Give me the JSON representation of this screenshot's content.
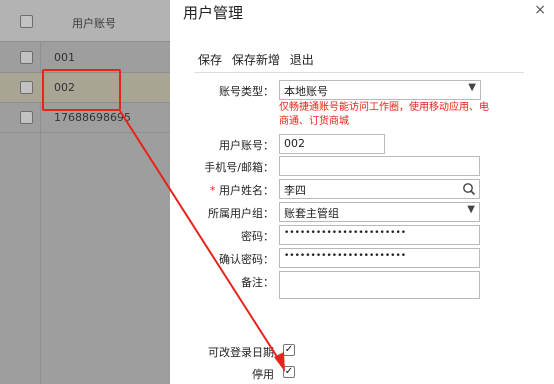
{
  "list": {
    "header": "用户账号",
    "rows": [
      "001",
      "002",
      "17688698695"
    ]
  },
  "dialog": {
    "title": "用户管理",
    "close": "×",
    "toolbar": {
      "save": "保存",
      "save_new": "保存新增",
      "exit": "退出"
    },
    "fields": {
      "account_type": {
        "label": "账号类型：",
        "value": "本地账号"
      },
      "account_type_note": "仅畅捷通账号能访问工作圈，使用移动应用、电商通、订货商城",
      "user_account": {
        "label": "用户账号：",
        "value": "002"
      },
      "phone_email": {
        "label": "手机号/邮箱：",
        "value": ""
      },
      "user_name": {
        "label": "用户姓名：",
        "value": "李四"
      },
      "user_group": {
        "label": "所属用户组：",
        "value": "账套主管组"
      },
      "password": {
        "label": "密码：",
        "value": "•••••••••••••••••••••••"
      },
      "confirm_password": {
        "label": "确认密码：",
        "value": "•••••••••••••••••••••••"
      },
      "remark": {
        "label": "备注：",
        "value": ""
      },
      "login_date": {
        "label": "可改登录日期",
        "checked": true
      },
      "disabled": {
        "label": "停用",
        "checked": true
      }
    }
  },
  "colors": {
    "highlight": "#e8231a",
    "required": "#e8231a"
  }
}
